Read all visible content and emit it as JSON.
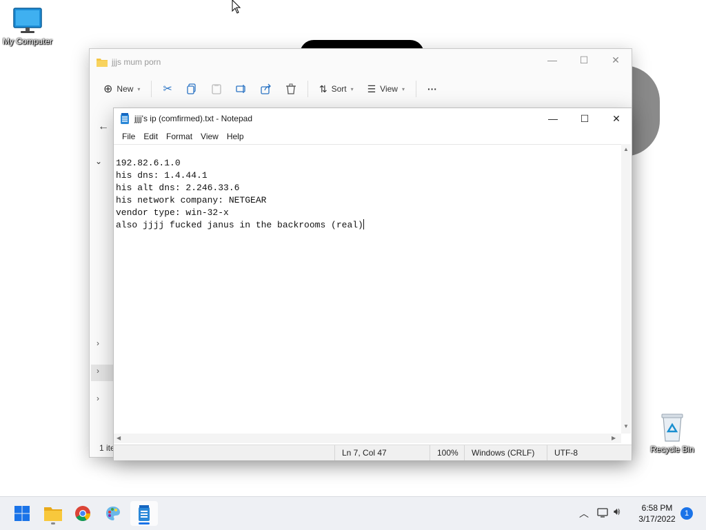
{
  "desktop": {
    "my_computer_label": "My Computer",
    "recycle_bin_label": "Recycle Bin"
  },
  "explorer": {
    "title": "jjjs mum porn",
    "toolbar": {
      "new_label": "New",
      "sort_label": "Sort",
      "view_label": "View",
      "more_label": "···"
    },
    "status_text": "1 ite"
  },
  "notepad": {
    "title": "jjjj's ip (comfirmed).txt - Notepad",
    "menu": [
      "File",
      "Edit",
      "Format",
      "View",
      "Help"
    ],
    "lines": [
      "192.82.6.1.0",
      "his dns: 1.4.44.1",
      "his alt dns: 2.246.33.6",
      "his network company: NETGEAR",
      "vendor type: win-32-x",
      "also jjjj fucked janus in the backrooms (real)"
    ],
    "status": {
      "position": "Ln 7, Col 47",
      "zoom": "100%",
      "line_ending": "Windows (CRLF)",
      "encoding": "UTF-8"
    }
  },
  "taskbar": {
    "time": "6:58 PM",
    "date": "3/17/2022",
    "notification_count": "1"
  },
  "colors": {
    "accent": "#1a73e8",
    "folder": "#f4c542",
    "taskbar_bg": "#eef0f4"
  }
}
